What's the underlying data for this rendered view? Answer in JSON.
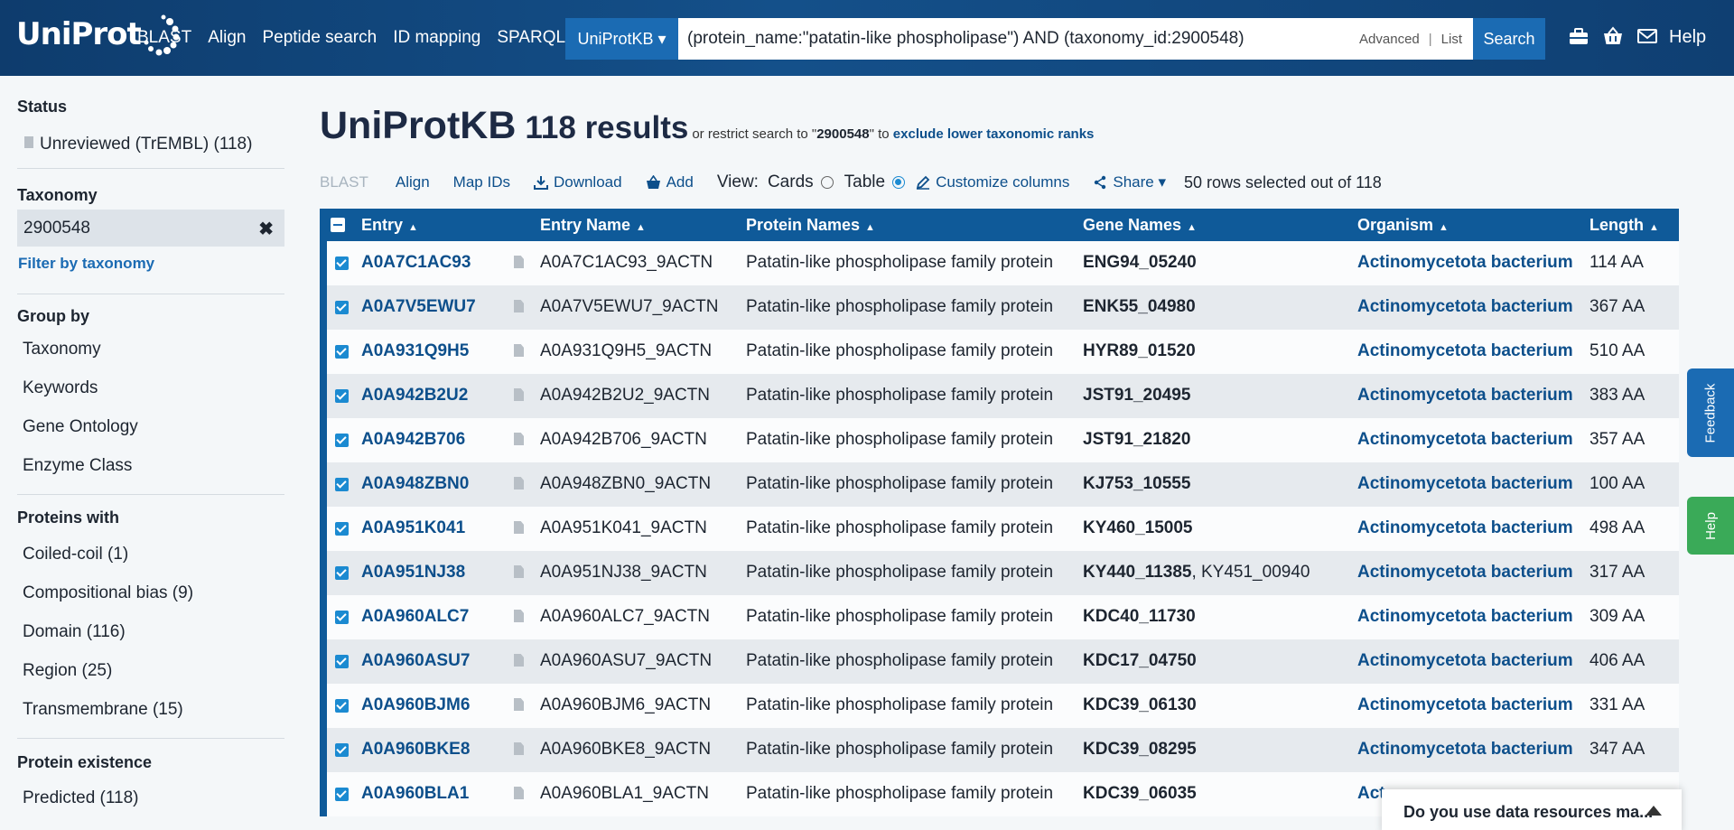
{
  "header": {
    "logo_text": "UniProt",
    "nav": [
      "BLAST",
      "Align",
      "Peptide search",
      "ID mapping",
      "SPARQL"
    ],
    "database": "UniProtKB ▾",
    "query": "(protein_name:\"patatin-like phospholipase\") AND (taxonomy_id:2900548)",
    "advanced": "Advanced",
    "separator": "|",
    "list": "List",
    "search_btn": "Search",
    "help": "Help",
    "icons": [
      "toolkit-icon",
      "basket-icon",
      "mail-icon"
    ]
  },
  "sidebar": {
    "status_title": "Status",
    "status_item": "Unreviewed (TrEMBL) (118)",
    "taxonomy_title": "Taxonomy",
    "taxonomy_value": "2900548",
    "taxonomy_clear": "✖",
    "filter_link": "Filter by taxonomy",
    "groupby_title": "Group by",
    "groupby_items": [
      "Taxonomy",
      "Keywords",
      "Gene Ontology",
      "Enzyme Class"
    ],
    "proteins_title": "Proteins with",
    "proteins_items": [
      "Coiled-coil (1)",
      "Compositional bias (9)",
      "Domain (116)",
      "Region (25)",
      "Transmembrane (15)"
    ],
    "existence_title": "Protein existence",
    "existence_items": [
      "Predicted (118)"
    ]
  },
  "results": {
    "db": "UniProtKB",
    "count": "118 results",
    "restrict_pre": "or restrict search to \"",
    "restrict_id": "2900548",
    "restrict_mid": "\" to ",
    "restrict_link": "exclude lower taxonomic ranks"
  },
  "toolbar": {
    "blast": "BLAST",
    "align": "Align",
    "map_ids": "Map IDs",
    "download": "Download",
    "add": "Add",
    "view_label": "View:",
    "cards": "Cards",
    "table": "Table",
    "customize": "Customize columns",
    "share": "Share ▾",
    "selected": "50 rows selected out of 118"
  },
  "table": {
    "columns": [
      "Entry",
      "Entry Name",
      "Protein Names",
      "Gene Names",
      "Organism",
      "Length"
    ],
    "rows": [
      {
        "entry": "A0A7C1AC93",
        "name": "A0A7C1AC93_9ACTN",
        "protein": "Patatin-like phospholipase family protein",
        "gene": "ENG94_05240",
        "gene_extra": "",
        "organism": "Actinomycetota bacterium",
        "length": "114 AA"
      },
      {
        "entry": "A0A7V5EWU7",
        "name": "A0A7V5EWU7_9ACTN",
        "protein": "Patatin-like phospholipase family protein",
        "gene": "ENK55_04980",
        "gene_extra": "",
        "organism": "Actinomycetota bacterium",
        "length": "367 AA"
      },
      {
        "entry": "A0A931Q9H5",
        "name": "A0A931Q9H5_9ACTN",
        "protein": "Patatin-like phospholipase family protein",
        "gene": "HYR89_01520",
        "gene_extra": "",
        "organism": "Actinomycetota bacterium",
        "length": "510 AA"
      },
      {
        "entry": "A0A942B2U2",
        "name": "A0A942B2U2_9ACTN",
        "protein": "Patatin-like phospholipase family protein",
        "gene": "JST91_20495",
        "gene_extra": "",
        "organism": "Actinomycetota bacterium",
        "length": "383 AA"
      },
      {
        "entry": "A0A942B706",
        "name": "A0A942B706_9ACTN",
        "protein": "Patatin-like phospholipase family protein",
        "gene": "JST91_21820",
        "gene_extra": "",
        "organism": "Actinomycetota bacterium",
        "length": "357 AA"
      },
      {
        "entry": "A0A948ZBN0",
        "name": "A0A948ZBN0_9ACTN",
        "protein": "Patatin-like phospholipase family protein",
        "gene": "KJ753_10555",
        "gene_extra": "",
        "organism": "Actinomycetota bacterium",
        "length": "100 AA"
      },
      {
        "entry": "A0A951K041",
        "name": "A0A951K041_9ACTN",
        "protein": "Patatin-like phospholipase family protein",
        "gene": "KY460_15005",
        "gene_extra": "",
        "organism": "Actinomycetota bacterium",
        "length": "498 AA"
      },
      {
        "entry": "A0A951NJ38",
        "name": "A0A951NJ38_9ACTN",
        "protein": "Patatin-like phospholipase family protein",
        "gene": "KY440_11385",
        "gene_extra": ", KY451_00940",
        "organism": "Actinomycetota bacterium",
        "length": "317 AA"
      },
      {
        "entry": "A0A960ALC7",
        "name": "A0A960ALC7_9ACTN",
        "protein": "Patatin-like phospholipase family protein",
        "gene": "KDC40_11730",
        "gene_extra": "",
        "organism": "Actinomycetota bacterium",
        "length": "309 AA"
      },
      {
        "entry": "A0A960ASU7",
        "name": "A0A960ASU7_9ACTN",
        "protein": "Patatin-like phospholipase family protein",
        "gene": "KDC17_04750",
        "gene_extra": "",
        "organism": "Actinomycetota bacterium",
        "length": "406 AA"
      },
      {
        "entry": "A0A960BJM6",
        "name": "A0A960BJM6_9ACTN",
        "protein": "Patatin-like phospholipase family protein",
        "gene": "KDC39_06130",
        "gene_extra": "",
        "organism": "Actinomycetota bacterium",
        "length": "331 AA"
      },
      {
        "entry": "A0A960BKE8",
        "name": "A0A960BKE8_9ACTN",
        "protein": "Patatin-like phospholipase family protein",
        "gene": "KDC39_08295",
        "gene_extra": "",
        "organism": "Actinomycetota bacterium",
        "length": "347 AA"
      },
      {
        "entry": "A0A960BLA1",
        "name": "A0A960BLA1_9ACTN",
        "protein": "Patatin-like phospholipase family protein",
        "gene": "KDC39_06035",
        "gene_extra": "",
        "organism": "Act",
        "length": ""
      }
    ]
  },
  "side_tabs": {
    "feedback": "Feedback",
    "help": "Help"
  },
  "survey": "Do you use data resources ma..."
}
